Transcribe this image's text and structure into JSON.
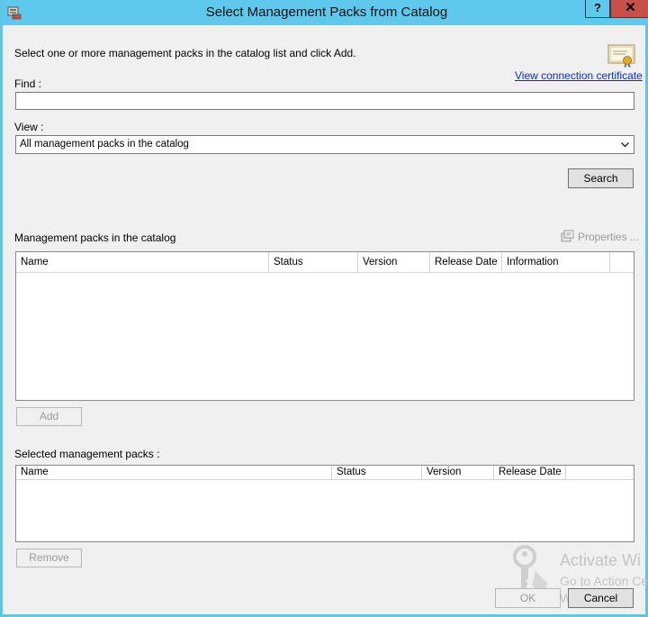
{
  "window": {
    "title": "Select Management Packs from Catalog",
    "help_label": "?",
    "close_label": "✕"
  },
  "instructions": "Select one or more management packs in the catalog list and click Add.",
  "certificate_link": "View connection certificate",
  "find": {
    "label": "Find :",
    "value": ""
  },
  "view": {
    "label": "View :",
    "selected": "All management packs in the catalog"
  },
  "search_button": "Search",
  "catalog": {
    "label": "Management packs in the catalog",
    "properties_label": "Properties ...",
    "columns": [
      "Name",
      "Status",
      "Version",
      "Release Date",
      "Information"
    ],
    "rows": []
  },
  "add_button": "Add",
  "selected": {
    "label": "Selected management packs :",
    "columns": [
      "Name",
      "Status",
      "Version",
      "Release Date"
    ],
    "rows": []
  },
  "remove_button": "Remove",
  "ok_button": "OK",
  "cancel_button": "Cancel",
  "watermark": {
    "line1": "Activate Wi",
    "line2": "Go to Action Ce",
    "line3": "Windows"
  },
  "colors": {
    "titlebar": "#5ec9ed",
    "close_button": "#c7504a",
    "link": "#0033cc"
  },
  "icons": {
    "title": "mp-catalog-icon",
    "certificate": "certificate-icon",
    "properties": "properties-icon",
    "watermark": "key-icon"
  }
}
